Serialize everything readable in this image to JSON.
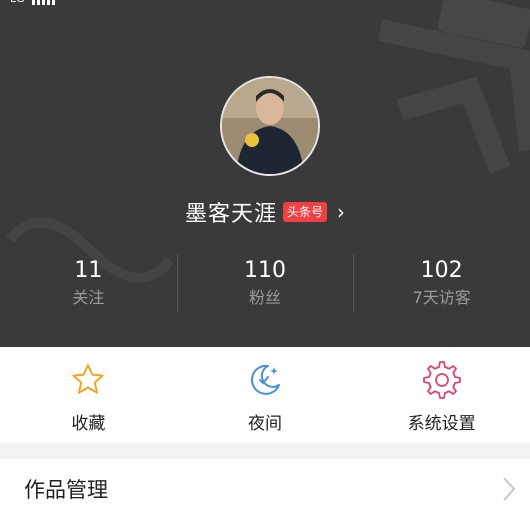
{
  "status_bar": {
    "carrier": "LG"
  },
  "profile": {
    "username": "墨客天涯",
    "badge": "头条号"
  },
  "stats": [
    {
      "value": "11",
      "label": "关注"
    },
    {
      "value": "110",
      "label": "粉丝"
    },
    {
      "value": "102",
      "label": "7天访客"
    }
  ],
  "actions": [
    {
      "label": "收藏",
      "icon": "star-icon",
      "color": "#f5a623"
    },
    {
      "label": "夜间",
      "icon": "moon-icon",
      "color": "#4a90d9"
    },
    {
      "label": "系统设置",
      "icon": "gear-icon",
      "color": "#e0426a"
    }
  ],
  "list": [
    {
      "label": "作品管理"
    }
  ],
  "colors": {
    "header_bg": "#3a3a3a",
    "badge_bg": "#f04142"
  }
}
